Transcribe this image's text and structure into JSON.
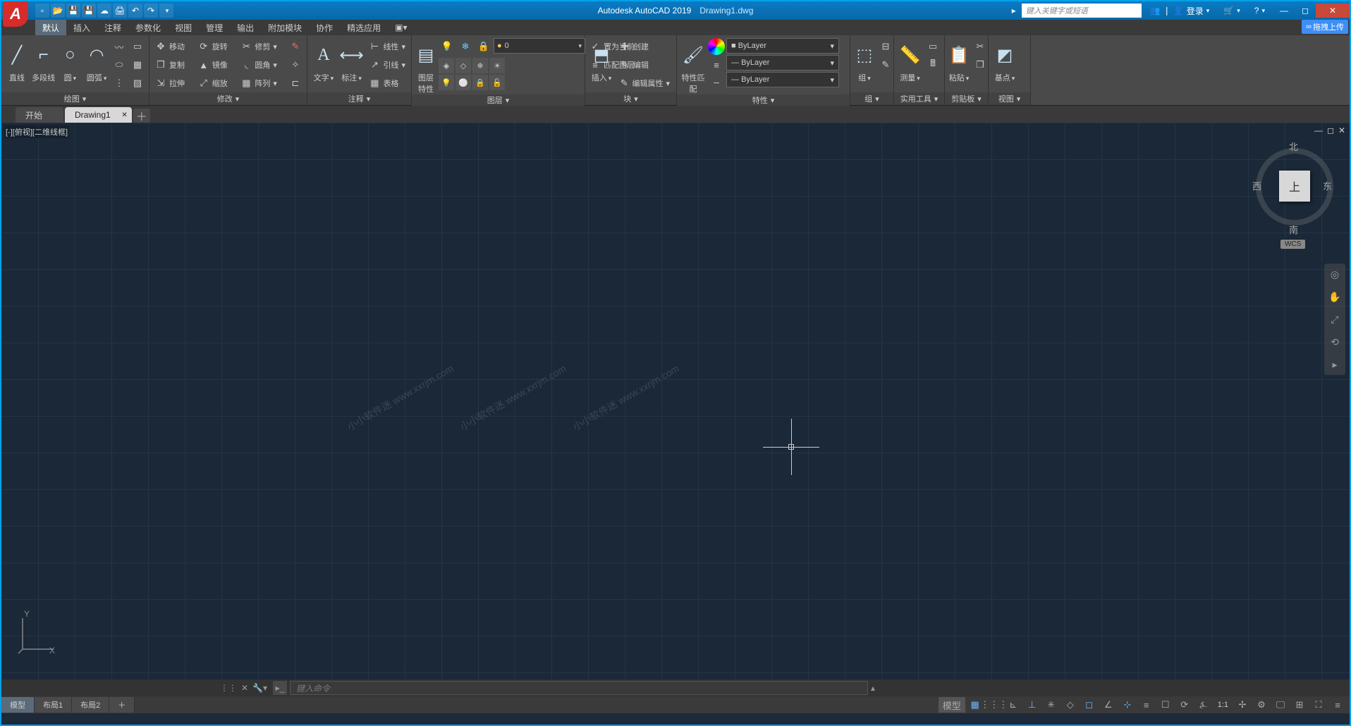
{
  "title": {
    "app": "Autodesk AutoCAD 2019",
    "file": "Drawing1.dwg"
  },
  "search": {
    "placeholder": "键入关键字或短语"
  },
  "login": {
    "label": "登录"
  },
  "upload_tag": "拖拽上传",
  "menus": [
    "默认",
    "插入",
    "注释",
    "参数化",
    "视图",
    "管理",
    "输出",
    "附加模块",
    "协作",
    "精选应用"
  ],
  "ribbon": {
    "draw": {
      "title": "绘图",
      "line": "直线",
      "polyline": "多段线",
      "circle": "圆",
      "arc": "圆弧"
    },
    "modify": {
      "title": "修改",
      "move": "移动",
      "copy": "复制",
      "stretch": "拉伸",
      "rotate": "旋转",
      "mirror": "镜像",
      "scale": "缩放",
      "trim": "修剪",
      "fillet": "圆角",
      "array": "阵列"
    },
    "annot": {
      "title": "注释",
      "text": "文字",
      "dim": "标注",
      "linetype": "线性",
      "leader": "引线",
      "table": "表格"
    },
    "layer": {
      "title": "图层",
      "props": "图层特性",
      "current": "0",
      "setcurrent": "置为当前",
      "match": "匹配图层"
    },
    "block": {
      "title": "块",
      "insert": "插入",
      "create": "创建",
      "edit": "编辑",
      "editattr": "编辑属性"
    },
    "props": {
      "title": "特性",
      "match": "特性匹配",
      "bylayer": "ByLayer"
    },
    "group": {
      "title": "组",
      "label": "组"
    },
    "util": {
      "title": "实用工具",
      "measure": "测量"
    },
    "clip": {
      "title": "剪贴板",
      "paste": "粘贴"
    },
    "view": {
      "title": "视图",
      "base": "基点"
    }
  },
  "filetabs": {
    "start": "开始",
    "drawing": "Drawing1"
  },
  "viewport": {
    "label": "[-][俯视][二维线框]"
  },
  "viewcube": {
    "top": "上",
    "n": "北",
    "s": "南",
    "e": "东",
    "w": "西",
    "wcs": "WCS"
  },
  "ucs": {
    "x": "X",
    "y": "Y"
  },
  "watermark": "小小软件迷 www.xxrjm.com",
  "cmd": {
    "placeholder": "键入命令"
  },
  "layouts": {
    "model": "模型",
    "l1": "布局1",
    "l2": "布局2"
  },
  "status": {
    "model": "模型",
    "scale": "1:1"
  }
}
